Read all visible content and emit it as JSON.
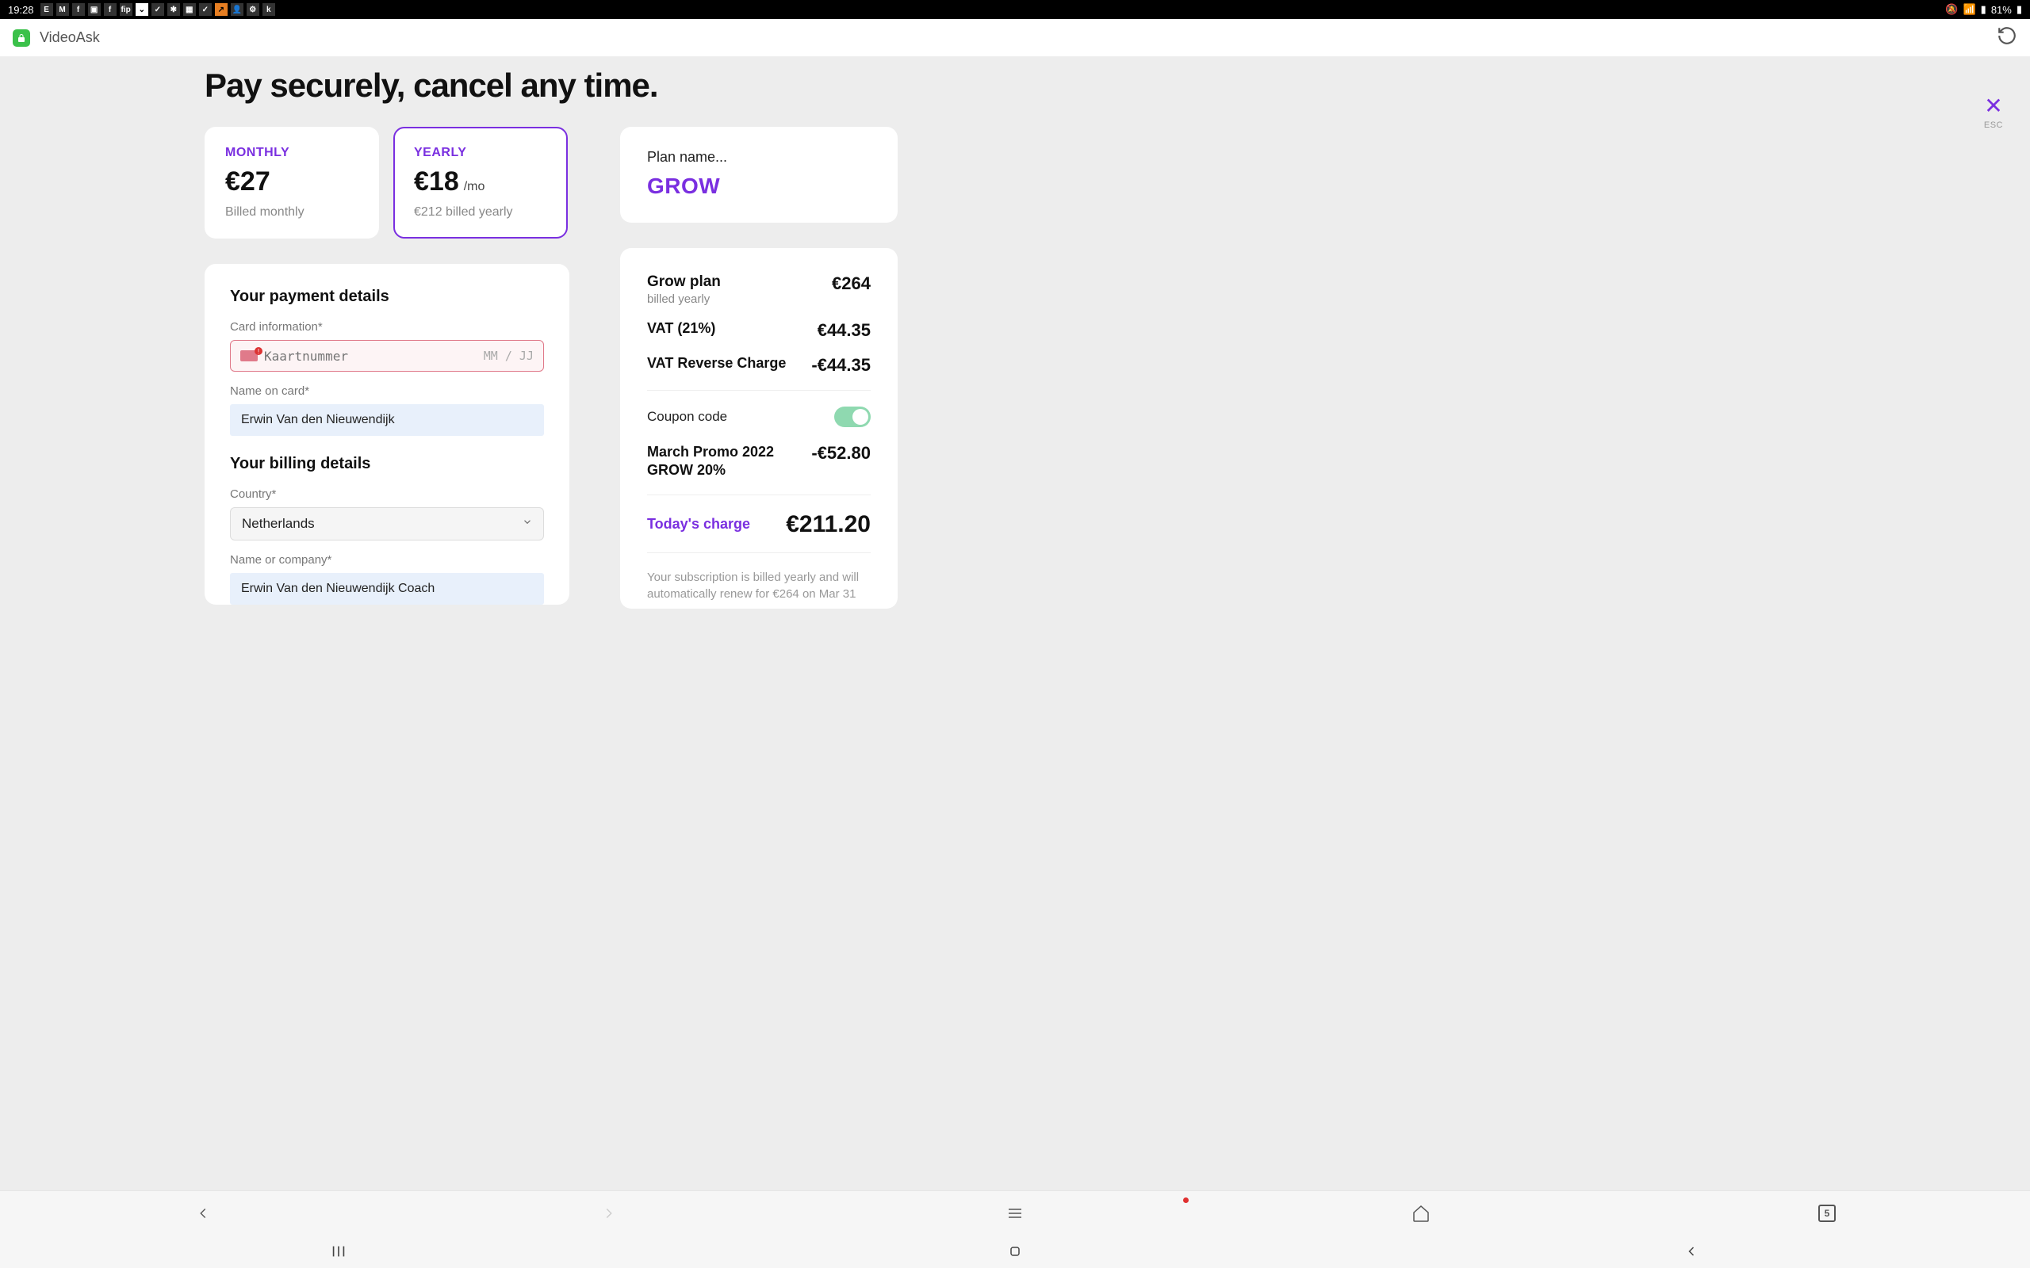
{
  "status": {
    "time": "19:28",
    "battery": "81%"
  },
  "appbar": {
    "title": "VideoAsk"
  },
  "esc": {
    "close": "✕",
    "label": "ESC"
  },
  "page": {
    "title": "Pay securely, cancel any time."
  },
  "plans": {
    "monthly": {
      "label": "MONTHLY",
      "price": "€27",
      "sub": "Billed monthly"
    },
    "yearly": {
      "label": "YEARLY",
      "price": "€18",
      "permo": "/mo",
      "sub": "€212 billed yearly"
    }
  },
  "planName": {
    "label": "Plan name...",
    "value": "GROW"
  },
  "payment": {
    "title": "Your payment details",
    "cardInfoLabel": "Card information*",
    "cardPlaceholder": "Kaartnummer",
    "cardExp": "MM  /  JJ",
    "nameLabel": "Name on card*",
    "nameValue": "Erwin Van den Nieuwendijk"
  },
  "billing": {
    "title": "Your billing details",
    "countryLabel": "Country*",
    "countryValue": "Netherlands",
    "companyLabel": "Name or company*",
    "companyValue": "Erwin Van den Nieuwendijk Coach"
  },
  "summary": {
    "planLabel": "Grow plan",
    "billedLabel": "billed yearly",
    "planAmount": "€264",
    "vatLabel": "VAT (21%)",
    "vatAmount": "€44.35",
    "vatReverseLabel": "VAT Reverse Charge",
    "vatReverseAmount": "-€44.35",
    "couponLabel": "Coupon code",
    "promoLine1": "March Promo 2022",
    "promoLine2": "GROW 20%",
    "promoAmount": "-€52.80",
    "todayLabel": "Today's charge",
    "todayAmount": "€211.20",
    "renewText": "Your subscription is billed yearly and will automatically renew for €264 on Mar 31"
  },
  "browserNav": {
    "tabCount": "5"
  }
}
